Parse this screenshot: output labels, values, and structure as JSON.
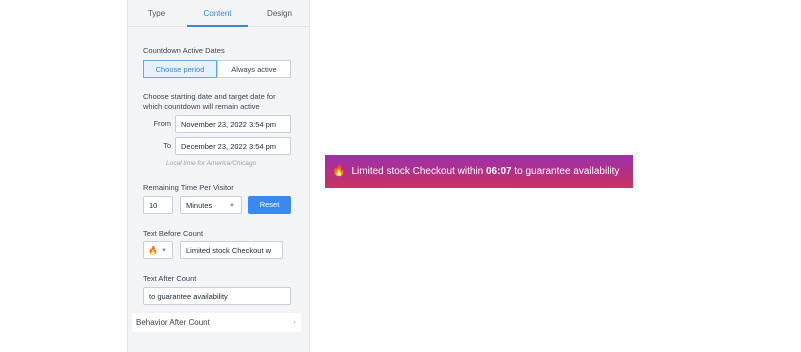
{
  "tabs": [
    {
      "label": "Type"
    },
    {
      "label": "Content"
    },
    {
      "label": "Design"
    }
  ],
  "countdown": {
    "section_label": "Countdown Active Dates",
    "options": [
      "Choose period",
      "Always active"
    ],
    "description": "Choose starting date and target date for which countdown will remain active",
    "from_label": "From",
    "from_value": "November 23, 2022 3:54 pm",
    "to_label": "To",
    "to_value": "December 23, 2022 3:54 pm",
    "timezone_note": "Local time for America/Chicago"
  },
  "remaining": {
    "label": "Remaining Time Per Visitor",
    "amount": "10",
    "unit": "Minutes",
    "reset_label": "Reset"
  },
  "text_before": {
    "label": "Text Before Count",
    "icon_glyph": "🔥",
    "icon_name": "fire-icon",
    "value": "Limited stock Checkout w"
  },
  "text_after": {
    "label": "Text After Count",
    "value": "to guarantee availability"
  },
  "behavior": {
    "label": "Behavior After Count"
  },
  "preview": {
    "icon": "🔥",
    "text_before": "Limited stock Checkout within",
    "count": "06:07",
    "text_after": "to guarantee availability",
    "gradient_top": "#9c2fae",
    "gradient_bottom": "#c8325f"
  }
}
